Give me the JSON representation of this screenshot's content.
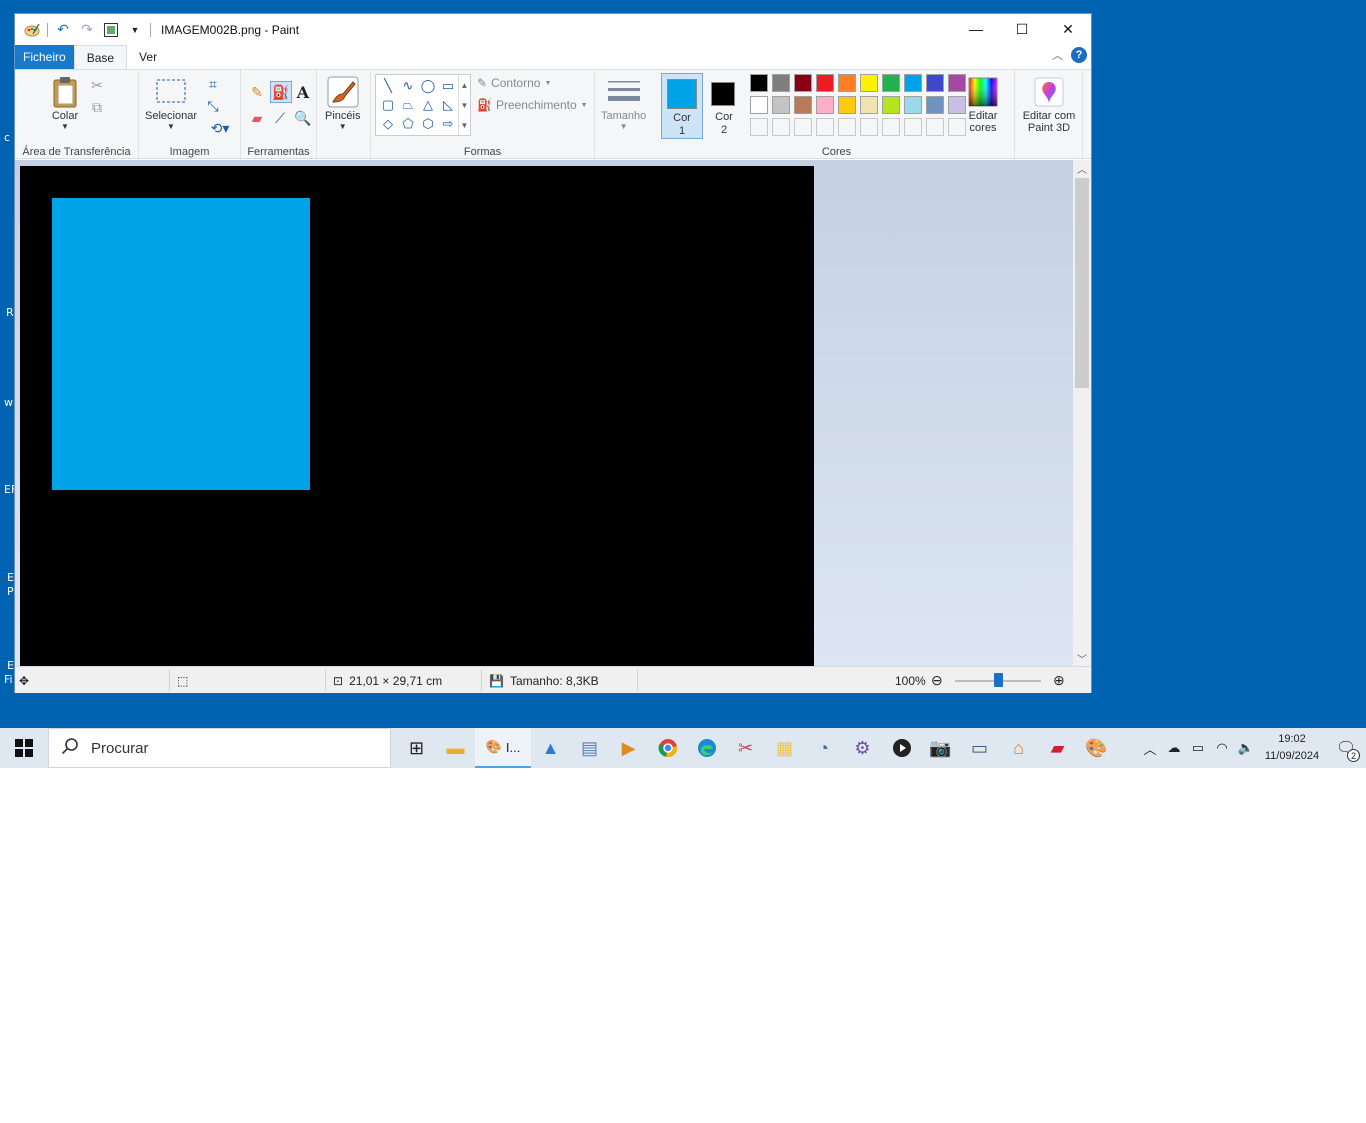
{
  "desktop": {
    "side_fragments": [
      "c",
      "R",
      "w",
      "EF",
      "E",
      "P",
      "E",
      "Fi"
    ]
  },
  "window": {
    "title": "IMAGEM002B.png - Paint",
    "controls": {
      "minimize_icon": "minimize-icon",
      "maximize_icon": "maximize-icon",
      "close_icon": "close-icon"
    }
  },
  "tabs": {
    "file": "Ficheiro",
    "home": "Base",
    "view": "Ver"
  },
  "ribbon": {
    "clipboard": {
      "paste": "Colar",
      "label": "Área de Transferência"
    },
    "image": {
      "select": "Selecionar",
      "label": "Imagem"
    },
    "tools": {
      "label": "Ferramentas"
    },
    "brushes": {
      "label": "Pincéis"
    },
    "shapes": {
      "outline": "Contorno",
      "fill": "Preenchimento",
      "label": "Formas"
    },
    "size": {
      "label": "Tamanho"
    },
    "colors": {
      "color1_line1": "Cor",
      "color1_line2": "1",
      "color2_line1": "Cor",
      "color2_line2": "2",
      "edit_line1": "Editar",
      "edit_line2": "cores",
      "label": "Cores",
      "color1": "#00a2e8",
      "color2": "#000000",
      "palette_row1": [
        "#000000",
        "#7f7f7f",
        "#880015",
        "#ed1c24",
        "#ff7f27",
        "#fff200",
        "#22b14c",
        "#00a2e8",
        "#3f48cc",
        "#a349a4"
      ],
      "palette_row2": [
        "#ffffff",
        "#c3c3c3",
        "#b97a57",
        "#ffaec9",
        "#ffc90e",
        "#efe4b0",
        "#b5e61d",
        "#99d9ea",
        "#7092be",
        "#c8bfe7"
      ],
      "palette_row3": [
        "#f5f6f7",
        "#f5f6f7",
        "#f5f6f7",
        "#f5f6f7",
        "#f5f6f7",
        "#f5f6f7",
        "#f5f6f7",
        "#f5f6f7",
        "#f5f6f7",
        "#f5f6f7"
      ]
    },
    "paint3d": {
      "line1": "Editar com",
      "line2": "Paint 3D"
    }
  },
  "status": {
    "dimensions": "21,01 × 29,71 cm",
    "file_size": "Tamanho: 8,3KB",
    "zoom": "100%"
  },
  "taskbar": {
    "search_placeholder": "Procurar",
    "active_app_label": "I...",
    "time": "19:02",
    "date": "11/09/2024",
    "notification_count": "2"
  }
}
